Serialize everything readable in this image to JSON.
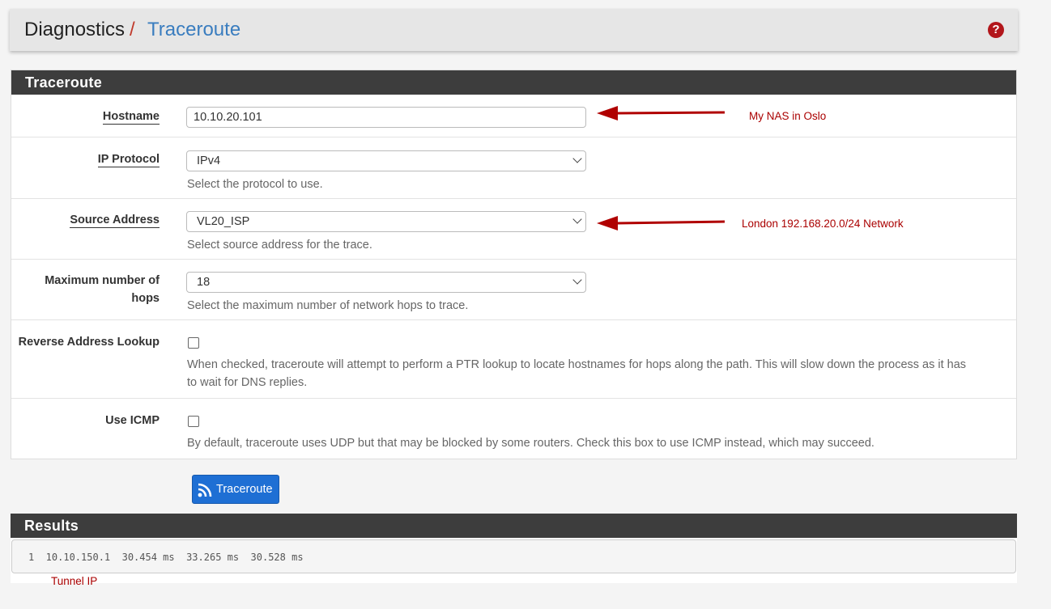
{
  "breadcrumb": {
    "parent": "Diagnostics",
    "separator": "/",
    "current": "Traceroute"
  },
  "help_icon": "question-circle-icon",
  "form_panel": {
    "title": "Traceroute",
    "hostname": {
      "label": "Hostname",
      "value": "10.10.20.101"
    },
    "ip_protocol": {
      "label": "IP Protocol",
      "selected": "IPv4",
      "help": "Select the protocol to use."
    },
    "source_address": {
      "label": "Source Address",
      "selected": "VL20_ISP",
      "help": "Select source address for the trace."
    },
    "max_hops": {
      "label_line1": "Maximum number of",
      "label_line2": "hops",
      "selected": "18",
      "help": "Select the maximum number of network hops to trace."
    },
    "reverse_lookup": {
      "label": "Reverse Address Lookup",
      "checked": false,
      "help_line1": "When checked, traceroute will attempt to perform a PTR lookup to locate hostnames for hops along the path. This will slow down the process as it has",
      "help_line2": "to wait for DNS replies."
    },
    "use_icmp": {
      "label": "Use ICMP",
      "checked": false,
      "help": "By default, traceroute uses UDP but that may be blocked by some routers. Check this box to use ICMP instead, which may succeed."
    }
  },
  "submit_button": {
    "label": "Traceroute",
    "icon": "rss-icon",
    "color": "#1e6fd4"
  },
  "results_panel": {
    "title": "Results",
    "output": "1  10.10.150.1  30.454 ms  33.265 ms  30.528 ms"
  },
  "annotations": {
    "hostname_note": "My NAS in Oslo",
    "source_note": "London 192.168.20.0/24 Network",
    "results_note": "Tunnel IP",
    "color": "#a00000"
  }
}
